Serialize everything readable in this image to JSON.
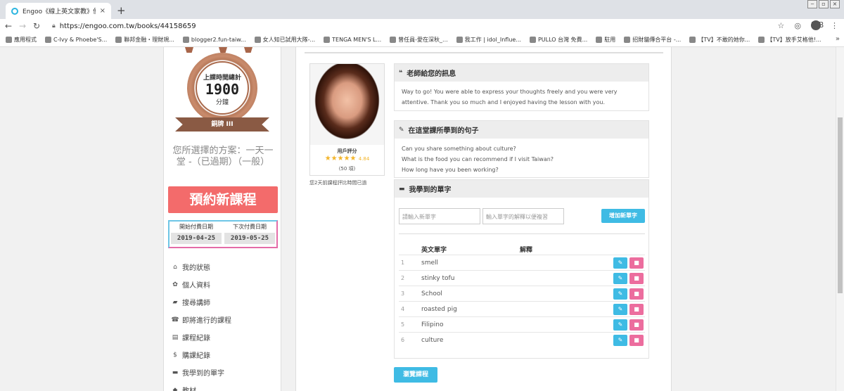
{
  "browser": {
    "tab_title": "Engoo《線上英文家教》便宜一對",
    "tab_close": "×",
    "new_tab": "+",
    "url": "https://engoo.com.tw/books/44158659",
    "profile": "K.B",
    "bookmarks": [
      "應用程式",
      "C-Ivy & Phoebe'S...",
      "聯邦金融・理財規...",
      "blogger2.fun-taiw...",
      "女人知已試用大隊-...",
      "TENGA MEN'S L...",
      "曾任員-愛在深秋_...",
      "我工作 | idol_Influe...",
      "PULLO 台灣 免費...",
      "駐用",
      "招財貓傳合平台 -...",
      "【TV】不敢的她你...",
      "【TV】放手艾格他!..."
    ],
    "more": "»"
  },
  "sidebar": {
    "medal_title": "上課時間總計",
    "medal_value": "1900",
    "medal_unit": "分鐘",
    "medal_rank": "銅牌 III",
    "plan_text": "您所選擇的方案：一天一堂 -（已過期）（一般）",
    "book_button": "預約新課程",
    "start_label": "開始付費日期",
    "start_date": "2019-04-25",
    "next_label": "下次付費日期",
    "next_date": "2019-05-25",
    "menu": [
      {
        "icon": "home-icon",
        "glyph": "⌂",
        "label": "我的狀態"
      },
      {
        "icon": "gear-icon",
        "glyph": "✿",
        "label": "個人資料"
      },
      {
        "icon": "book-icon",
        "glyph": "▰",
        "label": "搜尋講師"
      },
      {
        "icon": "bell-icon",
        "glyph": "☎",
        "label": "即將進行的課程"
      },
      {
        "icon": "calendar-icon",
        "glyph": "▤",
        "label": "課程紀錄"
      },
      {
        "icon": "dollar-icon",
        "glyph": "$",
        "label": "購課紀錄"
      },
      {
        "icon": "folder-icon",
        "glyph": "▬",
        "label": "我學到的單字"
      },
      {
        "icon": "tag-icon",
        "glyph": "◆",
        "label": "教材"
      }
    ]
  },
  "teacher": {
    "rating_label": "用戶評分",
    "stars": "★★★★★",
    "score": "4.84",
    "count": "(50 項)",
    "note": "您2天前課程評比時間已過"
  },
  "message": {
    "title": "老師給您的訊息",
    "body": "Way to go! You were able to express your thoughts freely and you were very attentive. Thank you so much and I enjoyed having the lesson with you."
  },
  "sentences": {
    "title": "在這堂課所學到的句子",
    "items": [
      "Can you share something about culture?",
      "What is the food you can recommend if I visit Taiwan?",
      "How long have you been working?"
    ]
  },
  "vocab": {
    "title": "我學到的單字",
    "word_placeholder": "請輸入新單字",
    "def_placeholder": "輸入單字的解釋以便複習",
    "add_button": "增加新單字",
    "col_word": "英文單字",
    "col_def": "解釋",
    "rows": [
      {
        "n": "1",
        "word": "smell",
        "def": ""
      },
      {
        "n": "2",
        "word": "stinky tofu",
        "def": ""
      },
      {
        "n": "3",
        "word": "School",
        "def": ""
      },
      {
        "n": "4",
        "word": "roasted pig",
        "def": ""
      },
      {
        "n": "5",
        "word": "Filipino",
        "def": ""
      },
      {
        "n": "6",
        "word": "culture",
        "def": ""
      }
    ],
    "edit_glyph": "✎",
    "delete_glyph": "■"
  },
  "browse_button": "瀏覽課程",
  "colors": {
    "accent_blue": "#3fbbe4",
    "accent_red": "#f36b6b",
    "delete_pink": "#ec6d9e",
    "medal_bronze": "#a9694b"
  }
}
